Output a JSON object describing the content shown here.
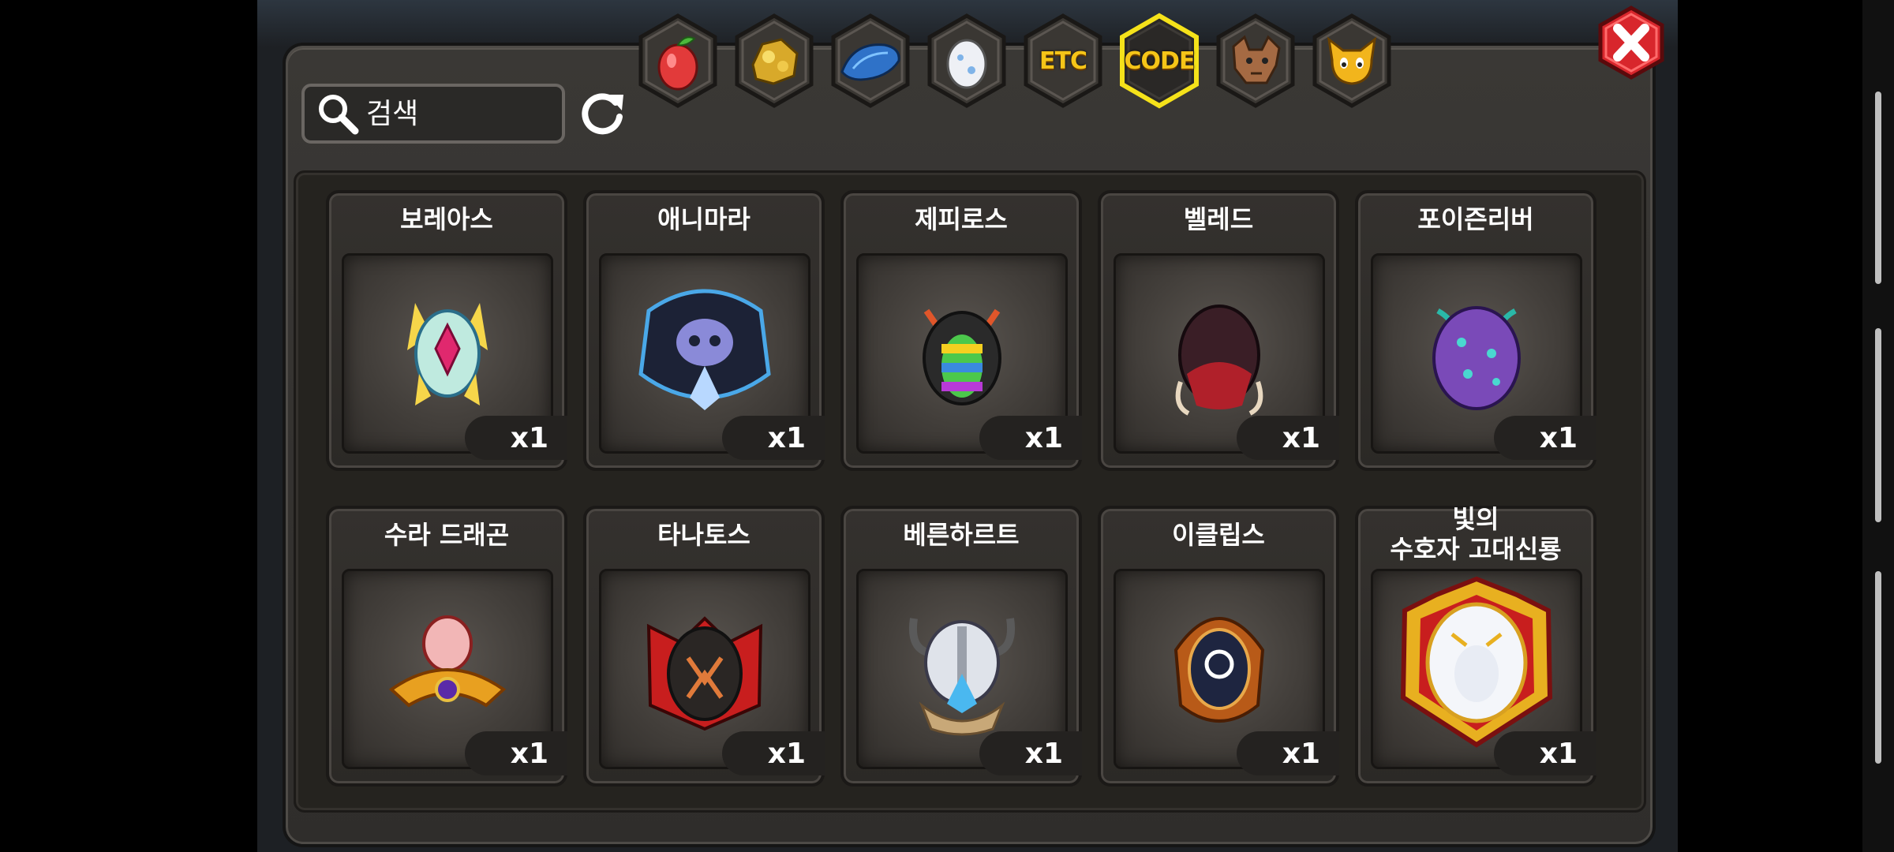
{
  "search": {
    "placeholder": "검색"
  },
  "tabs": [
    {
      "name": "fruit",
      "label": ""
    },
    {
      "name": "gold",
      "label": ""
    },
    {
      "name": "dragon-scale",
      "label": ""
    },
    {
      "name": "egg",
      "label": ""
    },
    {
      "name": "etc",
      "label": "ETC"
    },
    {
      "name": "code",
      "label": "CODE",
      "selected": true
    },
    {
      "name": "beast",
      "label": ""
    },
    {
      "name": "spirit",
      "label": ""
    }
  ],
  "items": [
    {
      "name": "보레아스",
      "count": "x1"
    },
    {
      "name": "애니마라",
      "count": "x1"
    },
    {
      "name": "제피로스",
      "count": "x1"
    },
    {
      "name": "벨레드",
      "count": "x1"
    },
    {
      "name": "포이즌리버",
      "count": "x1"
    },
    {
      "name": "수라 드래곤",
      "count": "x1"
    },
    {
      "name": "타나토스",
      "count": "x1"
    },
    {
      "name": "베른하르트",
      "count": "x1"
    },
    {
      "name": "이클립스",
      "count": "x1"
    },
    {
      "name_line1": "빛의",
      "name_line2": "수호자 고대신룡",
      "count": "x1"
    }
  ],
  "colors": {
    "accent": "#f5c518",
    "close": "#d8262c",
    "panel": "#34312e"
  }
}
